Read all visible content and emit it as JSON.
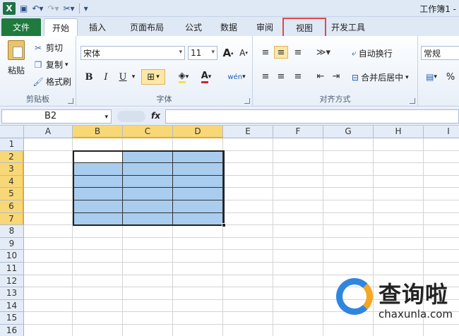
{
  "window": {
    "title": "工作簿1 -"
  },
  "quick_access": {
    "save_icon": "save-icon",
    "undo_icon": "undo-icon",
    "redo_icon": "redo-icon"
  },
  "tabs": [
    {
      "label": "文件"
    },
    {
      "label": "开始"
    },
    {
      "label": "插入"
    },
    {
      "label": "页面布局"
    },
    {
      "label": "公式"
    },
    {
      "label": "数据"
    },
    {
      "label": "审阅"
    },
    {
      "label": "视图"
    },
    {
      "label": "开发工具"
    }
  ],
  "ribbon": {
    "clipboard": {
      "paste": "粘贴",
      "cut": "剪切",
      "copy": "复制",
      "format_painter": "格式刷",
      "label": "剪贴板"
    },
    "font": {
      "name": "宋体",
      "size": "11",
      "bold": "B",
      "italic": "I",
      "underline": "U",
      "grow": "A",
      "shrink": "A",
      "font_color": "A",
      "phonetic": "wén",
      "label": "字体"
    },
    "alignment": {
      "wrap": "自动换行",
      "merge": "合并后居中",
      "label": "对齐方式"
    },
    "number": {
      "format": "常规",
      "percent": "%"
    }
  },
  "formula_bar": {
    "name_box": "B2",
    "fx": "fx",
    "content": ""
  },
  "columns": [
    "A",
    "B",
    "C",
    "D",
    "E",
    "F",
    "G",
    "H",
    "I"
  ],
  "selected_columns": [
    "B",
    "C",
    "D"
  ],
  "rows": [
    "1",
    "2",
    "3",
    "4",
    "5",
    "6",
    "7",
    "8",
    "9",
    "10",
    "11",
    "12",
    "13",
    "14",
    "15",
    "16"
  ],
  "selected_rows": [
    "2",
    "3",
    "4",
    "5",
    "6",
    "7"
  ],
  "selection": {
    "active_cell": "B2",
    "range": "B2:D7",
    "fill_color": "#a9cdef"
  },
  "watermark": {
    "cn": "查询啦",
    "en": "chaxunla.com"
  }
}
